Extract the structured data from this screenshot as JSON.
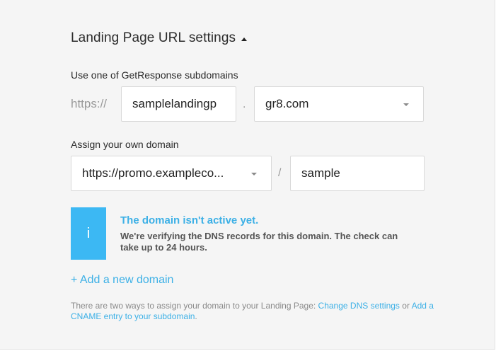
{
  "section": {
    "title": "Landing Page URL settings"
  },
  "subdomain": {
    "label": "Use one of GetResponse subdomains",
    "prefix": "https://",
    "value": "samplelandingp",
    "separator": ".",
    "domain_selected": "gr8.com"
  },
  "own_domain": {
    "label": "Assign your own domain",
    "domain_selected": "https://promo.exampleco...",
    "separator": "/",
    "path_value": "sample"
  },
  "info": {
    "icon_glyph": "i",
    "title": "The domain isn't active yet.",
    "text": "We're verifying the DNS records for this domain. The check can take up to 24 hours."
  },
  "add_domain_label": "+ Add a new domain",
  "note": {
    "text_before": "There are two ways to assign your domain to your Landing Page: ",
    "link_dns": "Change DNS settings",
    "text_middle": " or ",
    "link_cname": "Add a CNAME entry to your subdomain",
    "text_after": "."
  },
  "colors": {
    "accent": "#3cb0e6",
    "info_bg": "#3cb8f3",
    "panel_bg": "#f5f5f5"
  }
}
